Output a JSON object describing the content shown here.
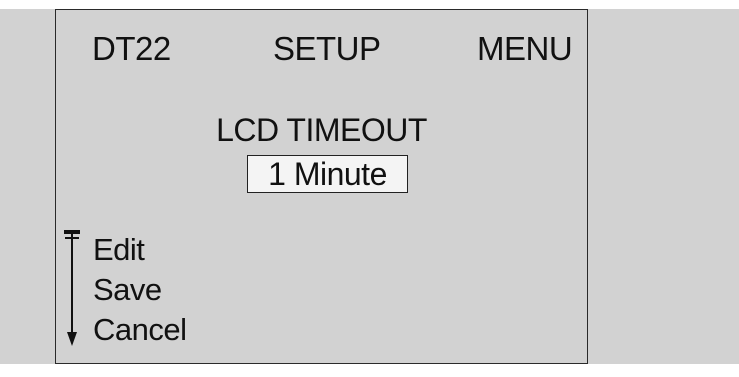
{
  "header": {
    "device": "DT22",
    "section": "SETUP",
    "menu": "MENU"
  },
  "setting": {
    "title": "LCD TIMEOUT",
    "value": "1 Minute"
  },
  "menu_items": [
    {
      "label": "Edit"
    },
    {
      "label": "Save"
    },
    {
      "label": "Cancel"
    }
  ],
  "icons": {
    "scroll_indicator": "scroll-down-arrow-icon"
  },
  "colors": {
    "background": "#d2d2d2",
    "text": "#111111",
    "value_box": "#f4f4f4"
  }
}
